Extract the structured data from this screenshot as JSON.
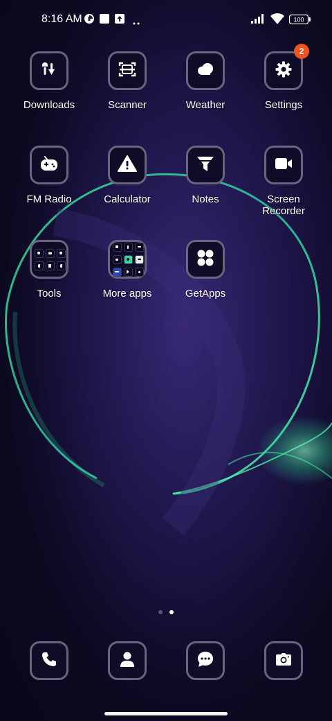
{
  "status_bar": {
    "time": "8:16 AM",
    "battery": "100",
    "icons": [
      "data-saver-icon",
      "square-notification-icon",
      "upload-notification-icon",
      "more-dots-icon",
      "signal-icon",
      "wifi-icon",
      "battery-icon"
    ]
  },
  "apps": [
    {
      "label": "Downloads",
      "icon": "downloads-icon"
    },
    {
      "label": "Scanner",
      "icon": "scanner-icon"
    },
    {
      "label": "Weather",
      "icon": "weather-icon"
    },
    {
      "label": "Settings",
      "icon": "gear-icon",
      "badge": "2"
    },
    {
      "label": "FM Radio",
      "icon": "radio-icon"
    },
    {
      "label": "Calculator",
      "icon": "calculator-icon"
    },
    {
      "label": "Notes",
      "icon": "notes-icon"
    },
    {
      "label": "Screen\nRecorder",
      "icon": "video-camera-icon"
    },
    {
      "label": "Tools",
      "icon": "folder-icon"
    },
    {
      "label": "More apps",
      "icon": "folder-icon"
    },
    {
      "label": "GetApps",
      "icon": "getapps-icon"
    }
  ],
  "page_indicator": {
    "pages": 2,
    "current": 2
  },
  "dock": [
    {
      "icon": "phone-icon"
    },
    {
      "icon": "contacts-icon"
    },
    {
      "icon": "messages-icon"
    },
    {
      "icon": "camera-icon"
    }
  ],
  "colors": {
    "badge": "#f0541e",
    "tile_border": "#6a6480",
    "tile_bg": "#0f0c28",
    "accent_glow": "#3ee8a0"
  }
}
